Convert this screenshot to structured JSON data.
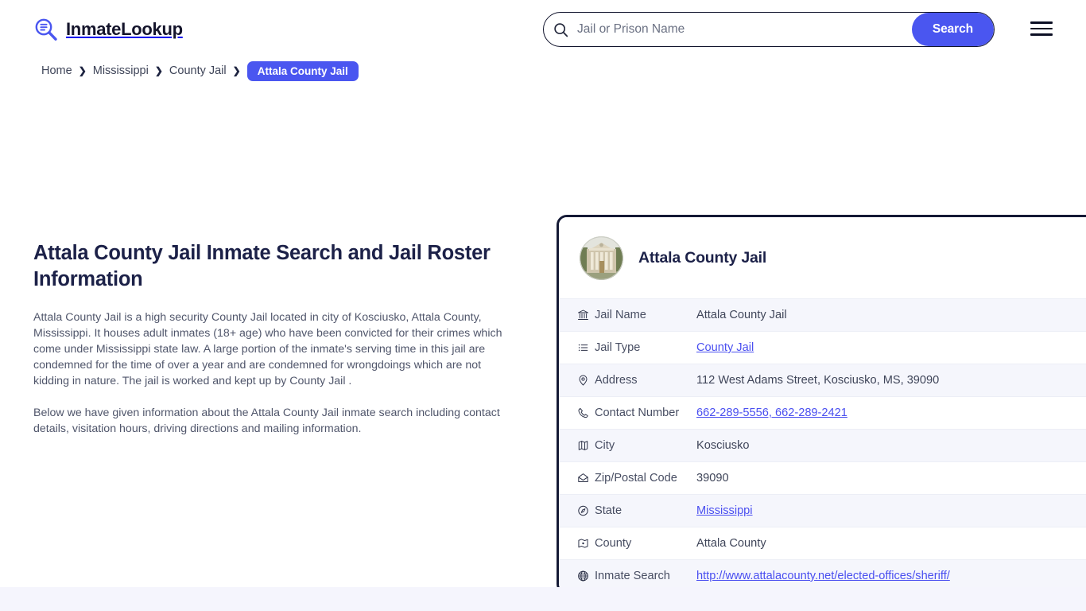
{
  "header": {
    "brand_name": "InmateLookup",
    "logo_icon": "magnifier-list-icon",
    "menu_icon": "hamburger-menu-icon"
  },
  "search": {
    "icon": "search-icon",
    "placeholder": "Jail or Prison Name",
    "value": "",
    "button_label": "Search"
  },
  "breadcrumb": {
    "items": [
      {
        "label": "Home",
        "current": false
      },
      {
        "label": "Mississippi",
        "current": false
      },
      {
        "label": "County Jail",
        "current": false
      },
      {
        "label": "Attala County Jail",
        "current": true
      }
    ],
    "separator": "❯"
  },
  "main": {
    "title": "Attala County Jail Inmate Search and Jail Roster Information",
    "paragraphs": [
      "Attala County Jail is a high security County Jail located in city of Kosciusko, Attala County, Mississippi. It houses adult inmates (18+ age) who have been convicted for their crimes which come under Mississippi state law. A large portion of the inmate's serving time in this jail are condemned for the time of over a year and are condemned for wrongdoings which are not kidding in nature. The jail is worked and kept up by County Jail .",
      "Below we have given information about the Attala County Jail inmate search including contact details, visitation hours, driving directions and mailing information."
    ]
  },
  "card": {
    "avatar_icon": "courthouse-photo",
    "title": "Attala County Jail",
    "rows": [
      {
        "icon": "bank-icon",
        "label": "Jail Name",
        "value": "Attala County Jail",
        "is_link": false
      },
      {
        "icon": "list-icon",
        "label": "Jail Type",
        "value": "County Jail",
        "is_link": true
      },
      {
        "icon": "map-pin-icon",
        "label": "Address",
        "value": "112 West Adams Street, Kosciusko, MS, 39090",
        "is_link": false
      },
      {
        "icon": "phone-icon",
        "label": "Contact Number",
        "value": "662-289-5556, 662-289-2421",
        "is_link": true
      },
      {
        "icon": "map-icon",
        "label": "City",
        "value": "Kosciusko",
        "is_link": false
      },
      {
        "icon": "envelope-icon",
        "label": "Zip/Postal Code",
        "value": "39090",
        "is_link": false
      },
      {
        "icon": "compass-icon",
        "label": "State",
        "value": "Mississippi",
        "is_link": true
      },
      {
        "icon": "map-marker-icon",
        "label": "County",
        "value": "Attala County",
        "is_link": false
      },
      {
        "icon": "globe-icon",
        "label": "Inmate Search",
        "value": "http://www.attalacounty.net/elected-offices/sheriff/",
        "is_link": true
      }
    ]
  },
  "colors": {
    "accent": "#4a56f0",
    "card_border": "#151a36",
    "link": "#4a4ff0",
    "title": "#1c2148",
    "row_alt": "#f5f6fc",
    "footer_band": "#f5f5fd"
  }
}
